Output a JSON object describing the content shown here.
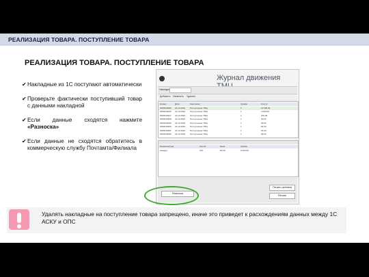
{
  "header": {
    "title": "РЕАЛИЗАЦИЯ ТОВАРА. ПОСТУПЛЕНИЕ ТОВАРА"
  },
  "main": {
    "title": "РЕАЛИЗАЦИЯ ТОВАРА. ПОСТУПЛЕНИЕ ТОВАРА",
    "bullets": [
      {
        "check": "✔",
        "text": "Накладные из 1С поступают автоматически"
      },
      {
        "check": "✔",
        "text": "Проверьте фактически поступивший товар с данными накладной"
      },
      {
        "check": "✔",
        "text_before": "Если данные сходятся нажмите ",
        "text_bold": "«Разноска»"
      },
      {
        "check": "✔",
        "text": "Если данные не сходятся обратитесь в коммерческую службу Почтамта/Филиала"
      }
    ]
  },
  "screenshot": {
    "window_title": "Журнал движения ТМЦ",
    "filter_label": "Накладные",
    "toolbar": [
      "Добавить",
      "Изменить",
      "Удалить"
    ],
    "table_rows": [
      [
        "Номер",
        "Дата",
        "Контрагент",
        "Сумма",
        "Статус"
      ],
      [
        "0000010925",
        "21.12.2016",
        "Поступление ТМЦ",
        "1",
        "10 000,00"
      ],
      [
        "0000010926",
        "21.12.2016",
        "Поступление ТМЦ",
        "1",
        "2 000,00"
      ],
      [
        "0000010927",
        "21.12.2016",
        "Поступление ТМЦ",
        "1",
        "200,00"
      ],
      [
        "0000010928",
        "21.12.2016",
        "Поступление ТМЦ",
        "1",
        "52,00"
      ],
      [
        "0000010929",
        "21.12.2016",
        "Поступление ТМЦ",
        "1",
        "36,00"
      ],
      [
        "0000010930",
        "21.12.2016",
        "Поступление ТМЦ",
        "1",
        "60,00"
      ],
      [
        "0000010931",
        "21.12.2016",
        "Поступление ТМЦ",
        "1",
        "45,00"
      ],
      [
        "0000010932",
        "21.12.2016",
        "Поступление ТМЦ",
        "1",
        "58,00"
      ]
    ],
    "detail_rows": [
      [
        "Номенклатура",
        "Кол-во",
        "Цена",
        "Сумма"
      ],
      [
        "Конверт",
        "100",
        "60,00",
        "6 000,00"
      ]
    ],
    "buttons": {
      "post": "Разноска",
      "print_prices": "Печать ценника",
      "print": "Печать"
    }
  },
  "warning": {
    "text": "Удалять накладные на поступление товара запрещено, иначе это приведет к расхождениям данных между 1С АСКУ и ОПС",
    "icon_color": "#f59ab1"
  }
}
